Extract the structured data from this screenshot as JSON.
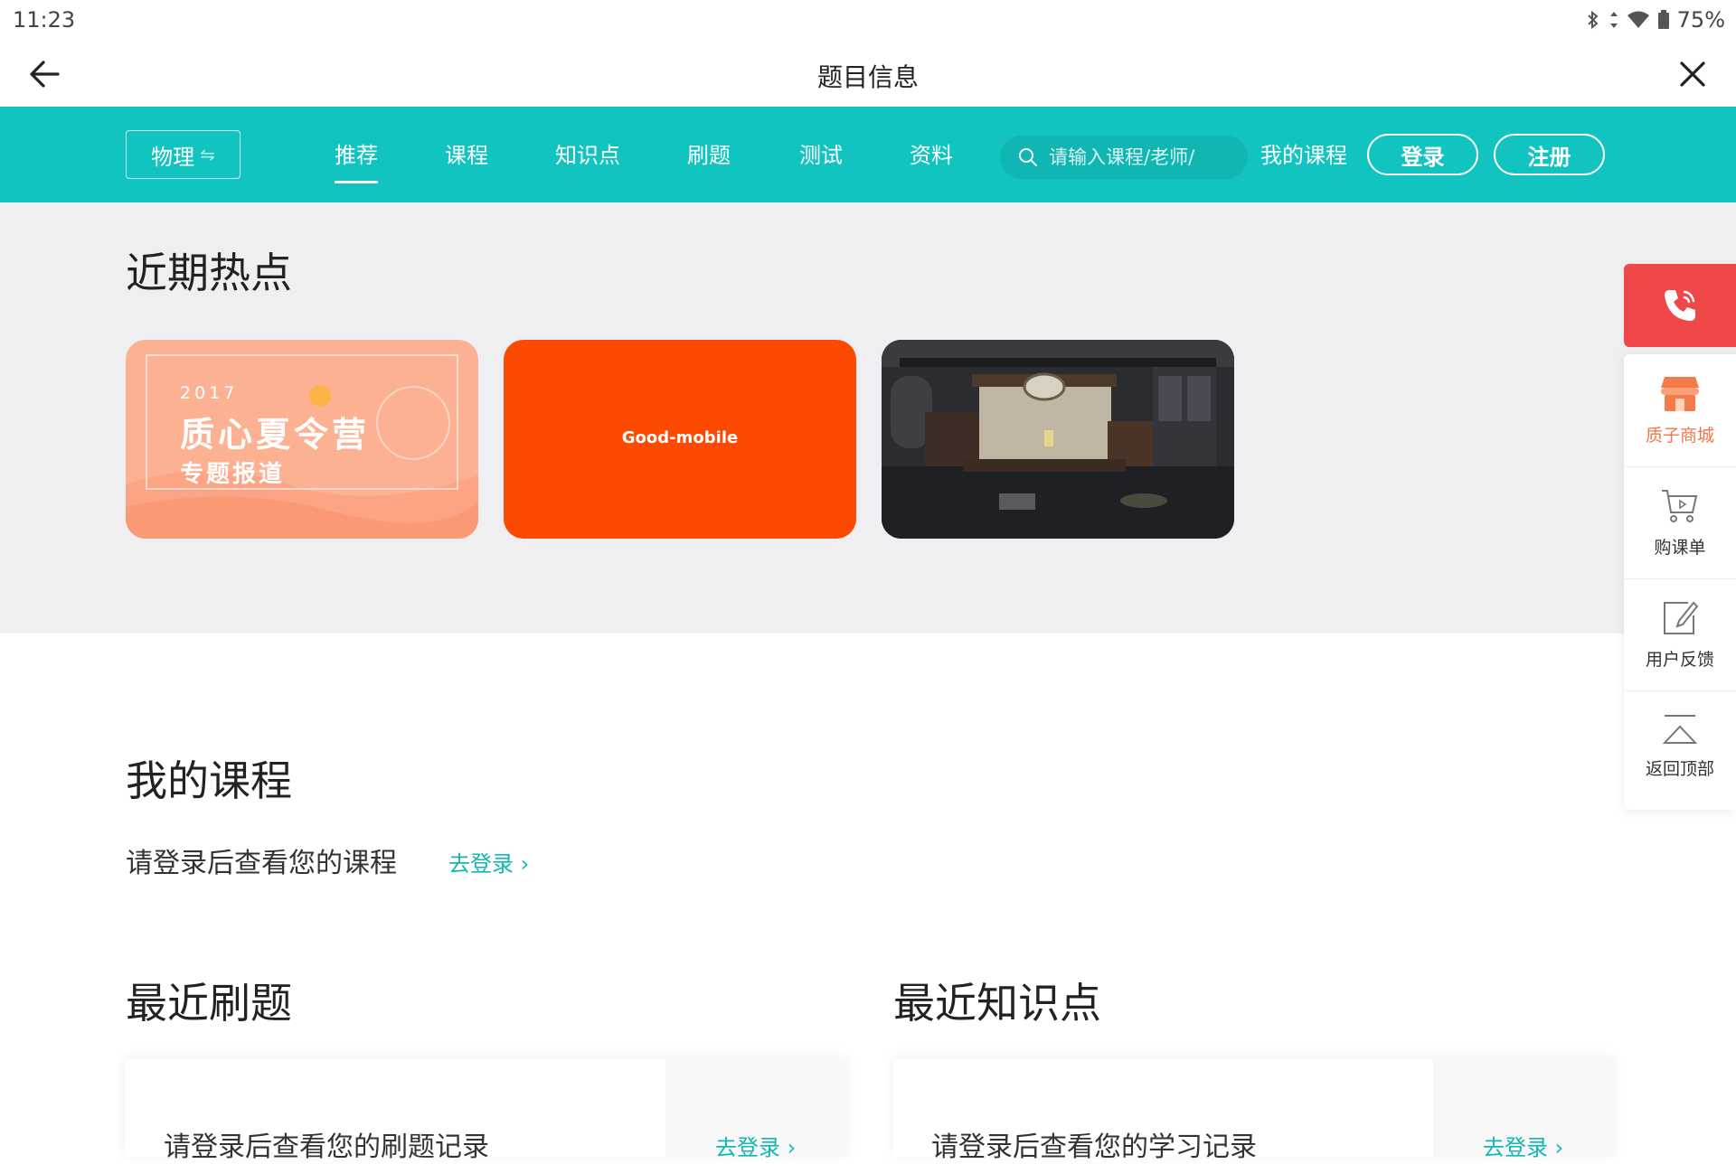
{
  "status_bar": {
    "time": "11:23",
    "battery": "75%"
  },
  "title_bar": {
    "title": "题目信息"
  },
  "nav": {
    "subject": "物理",
    "tabs": [
      {
        "label": "推荐",
        "active": true
      },
      {
        "label": "课程"
      },
      {
        "label": "知识点"
      },
      {
        "label": "刷题"
      },
      {
        "label": "测试"
      },
      {
        "label": "资料"
      }
    ],
    "search_placeholder": "请输入课程/老师/",
    "my_courses": "我的课程",
    "login": "登录",
    "register": "注册",
    "accent": "#12c4c0"
  },
  "hot": {
    "title": "近期热点",
    "banners": [
      {
        "year": "2017",
        "title": "质心夏令营",
        "subtitle": "专题报道",
        "color": "#fcb192"
      },
      {
        "text": "Good-mobile",
        "color": "#fd4a03"
      },
      {
        "scene": "room-illustration",
        "color": "#2d2e32"
      }
    ]
  },
  "my_courses": {
    "title": "我的课程",
    "prompt": "请登录后查看您的课程",
    "go_login": "去登录"
  },
  "recent_practice": {
    "title": "最近刷题",
    "prompt": "请登录后查看您的刷题记录",
    "go_login": "去登录"
  },
  "recent_knowledge": {
    "title": "最近知识点",
    "prompt": "请登录后查看您的学习记录",
    "go_login": "去登录"
  },
  "side_panel": {
    "items": [
      {
        "label": "质子商城",
        "icon": "shop-icon",
        "color": "#f2774a"
      },
      {
        "label": "购课单",
        "icon": "cart-icon"
      },
      {
        "label": "用户反馈",
        "icon": "feedback-icon"
      },
      {
        "label": "返回顶部",
        "icon": "back-to-top-icon"
      }
    ]
  }
}
